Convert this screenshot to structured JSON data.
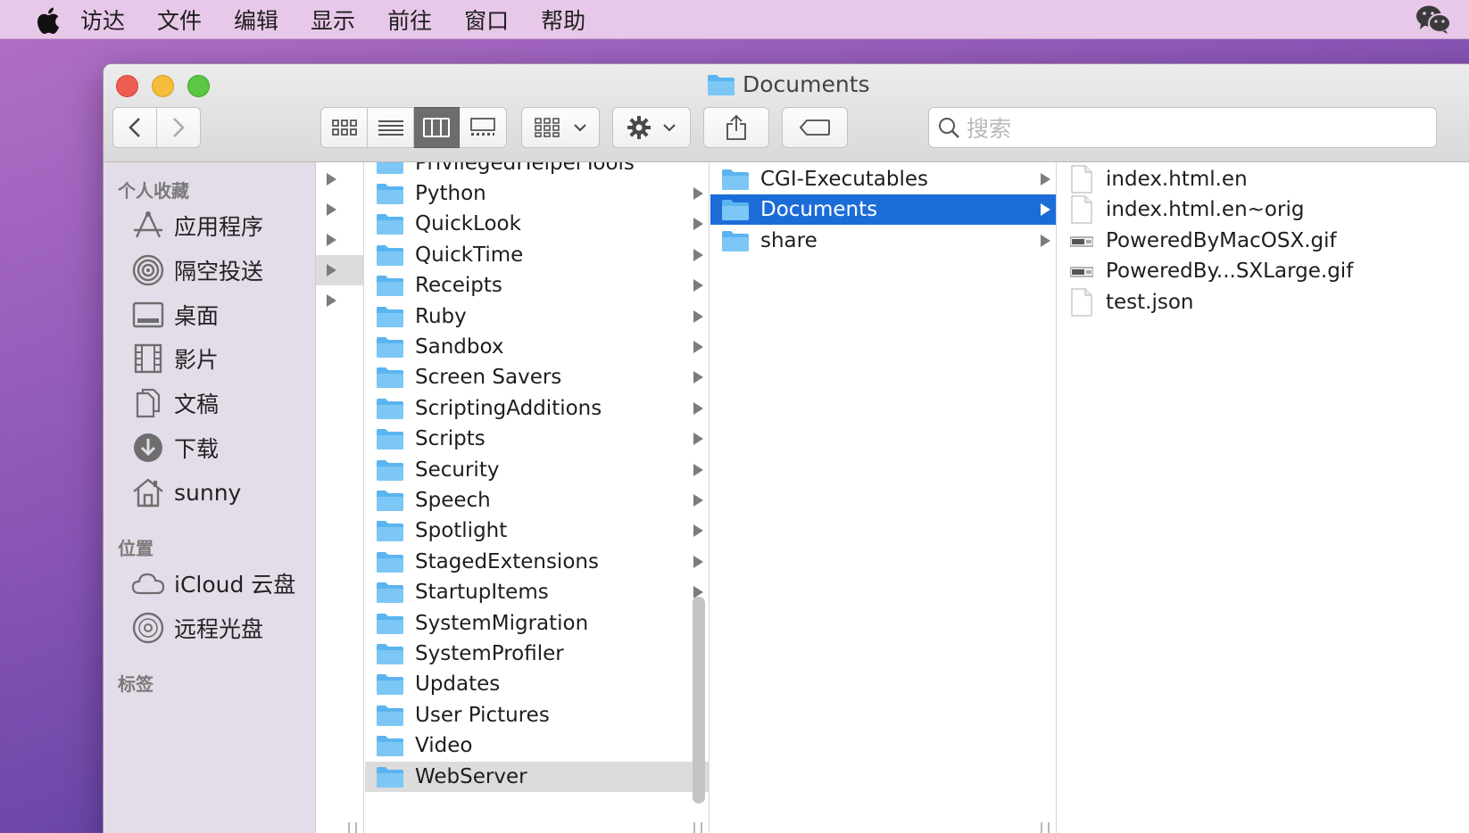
{
  "menubar": {
    "items": [
      "访达",
      "文件",
      "编辑",
      "显示",
      "前往",
      "窗口",
      "帮助"
    ]
  },
  "window": {
    "title": "Documents",
    "search_placeholder": "搜索"
  },
  "sidebar": {
    "favorites_header": "个人收藏",
    "favorites": [
      {
        "label": "应用程序",
        "icon": "applications-icon"
      },
      {
        "label": "隔空投送",
        "icon": "airdrop-icon"
      },
      {
        "label": "桌面",
        "icon": "desktop-icon"
      },
      {
        "label": "影片",
        "icon": "movies-icon"
      },
      {
        "label": "文稿",
        "icon": "documents-icon"
      },
      {
        "label": "下载",
        "icon": "downloads-icon"
      },
      {
        "label": "sunny",
        "icon": "home-icon"
      }
    ],
    "locations_header": "位置",
    "locations": [
      {
        "label": "iCloud 云盘",
        "icon": "icloud-icon"
      },
      {
        "label": "远程光盘",
        "icon": "remote-disc-icon"
      }
    ],
    "tags_header": "标签"
  },
  "columns": {
    "col1_partial": "PrivilegedHelperTools",
    "col1": [
      "Python",
      "QuickLook",
      "QuickTime",
      "Receipts",
      "Ruby",
      "Sandbox",
      "Screen Savers",
      "ScriptingAdditions",
      "Scripts",
      "Security",
      "Speech",
      "Spotlight",
      "StagedExtensions",
      "StartupItems",
      "SystemMigration",
      "SystemProfiler",
      "Updates",
      "User Pictures",
      "Video",
      "WebServer"
    ],
    "col1_selected": "WebServer",
    "col2": [
      "CGI-Executables",
      "Documents",
      "share"
    ],
    "col2_selected": "Documents",
    "col3": [
      {
        "name": "index.html.en",
        "kind": "document"
      },
      {
        "name": "index.html.en~orig",
        "kind": "document"
      },
      {
        "name": "PoweredByMacOSX.gif",
        "kind": "image"
      },
      {
        "name": "PoweredBy...SXLarge.gif",
        "kind": "image"
      },
      {
        "name": "test.json",
        "kind": "document"
      }
    ]
  },
  "colors": {
    "selection_blue": "#1c6cd8",
    "folder_blue": "#5ab4f0",
    "menubar_bg": "#e8c8e8",
    "sidebar_bg": "#e4dde9"
  }
}
